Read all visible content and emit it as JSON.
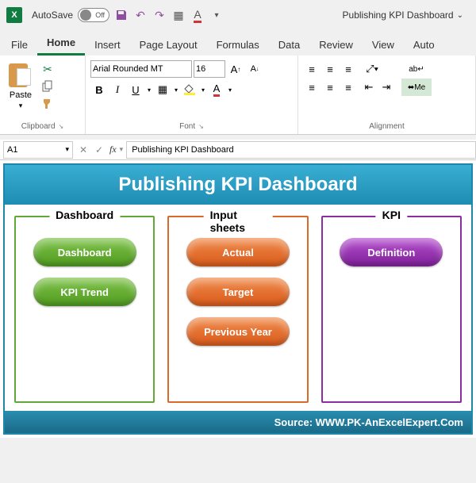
{
  "titlebar": {
    "autosave_label": "AutoSave",
    "autosave_state": "Off",
    "doc_title": "Publishing KPI Dashboard"
  },
  "tabs": {
    "file": "File",
    "home": "Home",
    "insert": "Insert",
    "page_layout": "Page Layout",
    "formulas": "Formulas",
    "data": "Data",
    "review": "Review",
    "view": "View",
    "auto": "Auto"
  },
  "ribbon": {
    "clipboard": {
      "paste": "Paste",
      "group_label": "Clipboard"
    },
    "font": {
      "name": "Arial Rounded MT",
      "size": "16",
      "group_label": "Font"
    },
    "alignment": {
      "group_label": "Alignment",
      "merge": "Me"
    }
  },
  "formula_bar": {
    "cell_ref": "A1",
    "fx": "fx",
    "value": "Publishing KPI Dashboard"
  },
  "sheet": {
    "banner": "Publishing KPI Dashboard",
    "cards": {
      "dashboard": {
        "title": "Dashboard",
        "btn1": "Dashboard",
        "btn2": "KPI Trend"
      },
      "input": {
        "title": "Input sheets",
        "btn1": "Actual",
        "btn2": "Target",
        "btn3": "Previous Year"
      },
      "kpi": {
        "title": "KPI",
        "btn1": "Definition"
      }
    },
    "footer": "Source: WWW.PK-AnExcelExpert.Com"
  }
}
